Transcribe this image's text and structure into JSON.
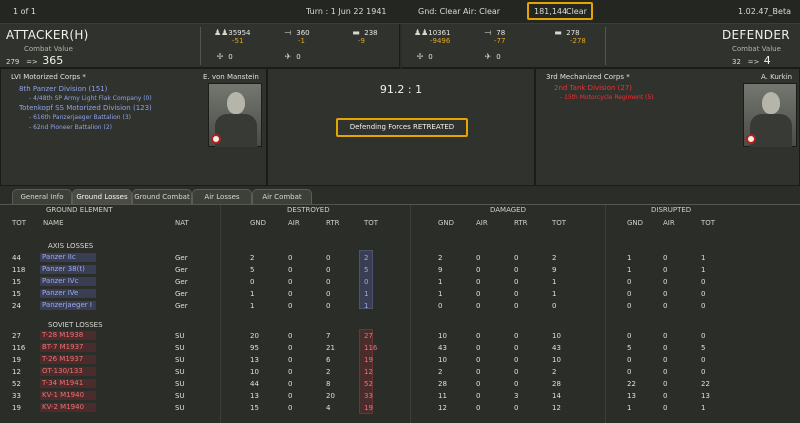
{
  "topbar": {
    "page": "1 of 1",
    "turn": "Turn : 1   Jun 22 1941",
    "weather": "Gnd: Clear  Air: Clear",
    "combat_id": "181,144",
    "combat_weather": "Clear",
    "version": "1.02.47_Beta"
  },
  "attacker": {
    "title": "ATTACKER(H)",
    "cv_label": "Combat Value",
    "cv_before": "279",
    "arrow": "=>",
    "cv_after": "365",
    "men": "35954",
    "men_loss": "-51",
    "guns": "360",
    "guns_loss": "-1",
    "tanks": "238",
    "tanks_loss": "-9",
    "planes_a": "0",
    "planes_b": "0"
  },
  "defender": {
    "title": "DEFENDER",
    "cv_label": "Combat Value",
    "cv_before": "32",
    "arrow": "=>",
    "cv_after": "4",
    "men": "10361",
    "men_loss": "-9496",
    "guns": "78",
    "guns_loss": "-77",
    "tanks": "278",
    "tanks_loss": "-278",
    "planes_a": "0",
    "planes_b": "0"
  },
  "axis_panel": {
    "corps": "LVI Motorized Corps *",
    "commander": "E. von Manstein",
    "units": [
      {
        "name": "8th Panzer Division (151)",
        "level": "div"
      },
      {
        "name": "- 4/48th SP Army Light Flak Company (0)",
        "level": "sub"
      },
      {
        "name": "Totenkopf SS Motorized Division (123)",
        "level": "div"
      },
      {
        "name": "- 616th Panzerjaeger Battalion (3)",
        "level": "sub"
      },
      {
        "name": "- 62nd Pioneer Battalion (2)",
        "level": "sub"
      }
    ]
  },
  "result_panel": {
    "ratio": "91.2 : 1",
    "outcome": "Defending Forces RETREATED"
  },
  "soviet_panel": {
    "corps": "3rd Mechanized Corps *",
    "commander": "A. Kurkin",
    "units": [
      {
        "name": "2nd Tank Division (27)",
        "level": "div"
      },
      {
        "name": "- 15th Motorcycle Regiment (5)",
        "level": "sub"
      }
    ]
  },
  "tabs": [
    "General Info",
    "Ground Losses",
    "Ground Combat",
    "Air Losses",
    "Air Combat"
  ],
  "active_tab": "Ground Losses",
  "table": {
    "group_headers": {
      "element": "GROUND ELEMENT",
      "destroyed": "DESTROYED",
      "damaged": "DAMAGED",
      "disrupted": "DISRUPTED"
    },
    "columns": [
      "TOT",
      "NAME",
      "NAT",
      "GND",
      "AIR",
      "RTR",
      "TOT",
      "GND",
      "AIR",
      "RTR",
      "TOT",
      "GND",
      "AIR",
      "TOT"
    ],
    "axis_title": "AXIS LOSSES",
    "axis_rows": [
      [
        "44",
        "Panzer IIc",
        "Ger",
        "2",
        "0",
        "0",
        "2",
        "2",
        "0",
        "0",
        "2",
        "1",
        "0",
        "1"
      ],
      [
        "118",
        "Panzer 38(t)",
        "Ger",
        "5",
        "0",
        "0",
        "5",
        "9",
        "0",
        "0",
        "9",
        "1",
        "0",
        "1"
      ],
      [
        "15",
        "Panzer IVc",
        "Ger",
        "0",
        "0",
        "0",
        "0",
        "1",
        "0",
        "0",
        "1",
        "0",
        "0",
        "0"
      ],
      [
        "15",
        "Panzer IVe",
        "Ger",
        "1",
        "0",
        "0",
        "1",
        "1",
        "0",
        "0",
        "1",
        "0",
        "0",
        "0"
      ],
      [
        "24",
        "Panzerjaeger I",
        "Ger",
        "1",
        "0",
        "0",
        "1",
        "0",
        "0",
        "0",
        "0",
        "0",
        "0",
        "0"
      ]
    ],
    "soviet_title": "SOVIET LOSSES",
    "soviet_rows": [
      [
        "27",
        "T-28 M1938",
        "SU",
        "20",
        "0",
        "7",
        "27",
        "10",
        "0",
        "0",
        "10",
        "0",
        "0",
        "0"
      ],
      [
        "116",
        "BT-7 M1937",
        "SU",
        "95",
        "0",
        "21",
        "116",
        "43",
        "0",
        "0",
        "43",
        "5",
        "0",
        "5"
      ],
      [
        "19",
        "T-26 M1937",
        "SU",
        "13",
        "0",
        "6",
        "19",
        "10",
        "0",
        "0",
        "10",
        "0",
        "0",
        "0"
      ],
      [
        "12",
        "OT-130/133",
        "SU",
        "10",
        "0",
        "2",
        "12",
        "2",
        "0",
        "0",
        "2",
        "0",
        "0",
        "0"
      ],
      [
        "52",
        "T-34 M1941",
        "SU",
        "44",
        "0",
        "8",
        "52",
        "28",
        "0",
        "0",
        "28",
        "22",
        "0",
        "22"
      ],
      [
        "33",
        "KV-1 M1940",
        "SU",
        "13",
        "0",
        "20",
        "33",
        "11",
        "0",
        "3",
        "14",
        "13",
        "0",
        "13"
      ],
      [
        "19",
        "KV-2 M1940",
        "SU",
        "15",
        "0",
        "4",
        "19",
        "12",
        "0",
        "0",
        "12",
        "1",
        "0",
        "1"
      ]
    ]
  }
}
